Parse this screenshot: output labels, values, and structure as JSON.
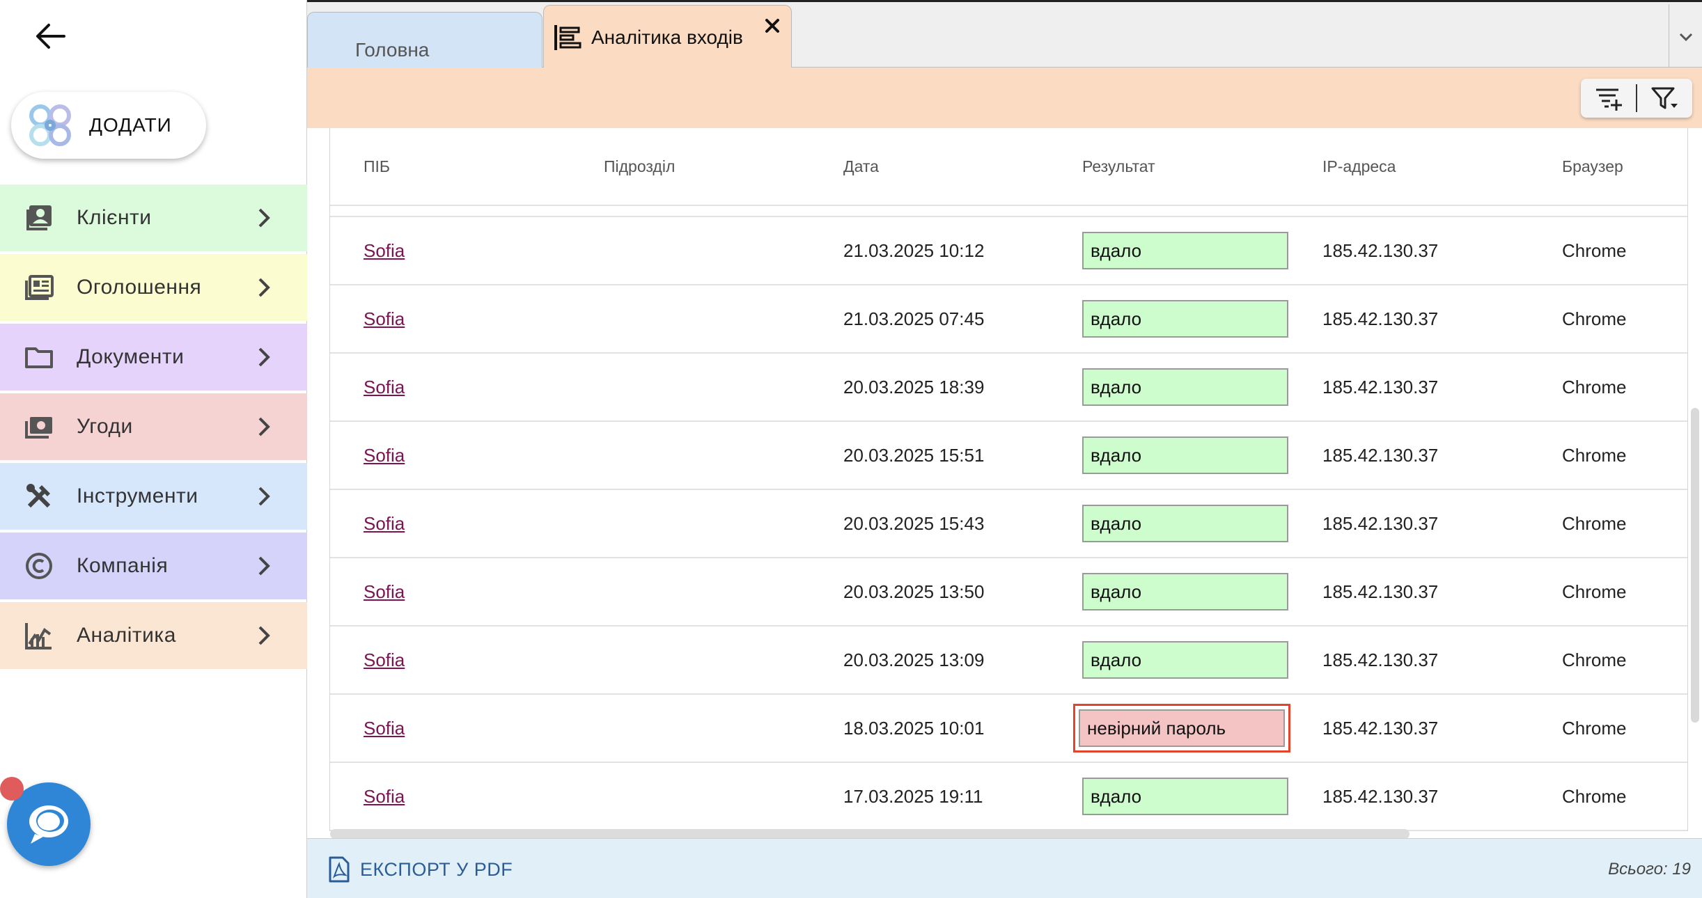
{
  "sidebar": {
    "add_label": "ДОДАТИ",
    "items": [
      {
        "label": "Клієнти",
        "color": "#dcfadc",
        "icon": "contacts-icon"
      },
      {
        "label": "Оголошення",
        "color": "#fbfcd0",
        "icon": "newspaper-icon"
      },
      {
        "label": "Документи",
        "color": "#e6d3fb",
        "icon": "folder-icon"
      },
      {
        "label": "Угоди",
        "color": "#f6d3d3",
        "icon": "money-icon"
      },
      {
        "label": "Інструменти",
        "color": "#d6e6fb",
        "icon": "tools-icon"
      },
      {
        "label": "Компанія",
        "color": "#d6d3fb",
        "icon": "copyright-icon"
      },
      {
        "label": "Аналітика",
        "color": "#fbe6d3",
        "icon": "analytics-icon"
      }
    ]
  },
  "tabs": {
    "home": "Головна",
    "analytics": "Аналітика входів"
  },
  "table": {
    "headers": [
      "ПІБ",
      "Підрозділ",
      "Дата",
      "Результат",
      "IP-адреса",
      "Браузер"
    ],
    "rows": [
      {
        "name": "Sofia",
        "dept": "",
        "date": "21.03.2025 10:12",
        "result": "вдало",
        "status": "ok",
        "ip": "185.42.130.37",
        "browser": "Chrome"
      },
      {
        "name": "Sofia",
        "dept": "",
        "date": "21.03.2025 07:45",
        "result": "вдало",
        "status": "ok",
        "ip": "185.42.130.37",
        "browser": "Chrome"
      },
      {
        "name": "Sofia",
        "dept": "",
        "date": "20.03.2025 18:39",
        "result": "вдало",
        "status": "ok",
        "ip": "185.42.130.37",
        "browser": "Chrome"
      },
      {
        "name": "Sofia",
        "dept": "",
        "date": "20.03.2025 15:51",
        "result": "вдало",
        "status": "ok",
        "ip": "185.42.130.37",
        "browser": "Chrome"
      },
      {
        "name": "Sofia",
        "dept": "",
        "date": "20.03.2025 15:43",
        "result": "вдало",
        "status": "ok",
        "ip": "185.42.130.37",
        "browser": "Chrome"
      },
      {
        "name": "Sofia",
        "dept": "",
        "date": "20.03.2025 13:50",
        "result": "вдало",
        "status": "ok",
        "ip": "185.42.130.37",
        "browser": "Chrome"
      },
      {
        "name": "Sofia",
        "dept": "",
        "date": "20.03.2025 13:09",
        "result": "вдало",
        "status": "ok",
        "ip": "185.42.130.37",
        "browser": "Chrome"
      },
      {
        "name": "Sofia",
        "dept": "",
        "date": "18.03.2025 10:01",
        "result": "невірний пароль",
        "status": "fail",
        "ip": "185.42.130.37",
        "browser": "Chrome",
        "highlighted": true
      },
      {
        "name": "Sofia",
        "dept": "",
        "date": "17.03.2025 19:11",
        "result": "вдало",
        "status": "ok",
        "ip": "185.42.130.37",
        "browser": "Chrome"
      }
    ]
  },
  "footer": {
    "export_label": "ЕКСПОРТ У PDF",
    "total": "Всього: 19"
  },
  "colors": {
    "accent_tab": "#fbdcc2",
    "home_tab": "#d3e4f7",
    "ok": "#cdfccd",
    "fail": "#f4c4c4",
    "highlight": "#e4432c",
    "link": "#7b1551",
    "chat": "#2f86d6"
  }
}
